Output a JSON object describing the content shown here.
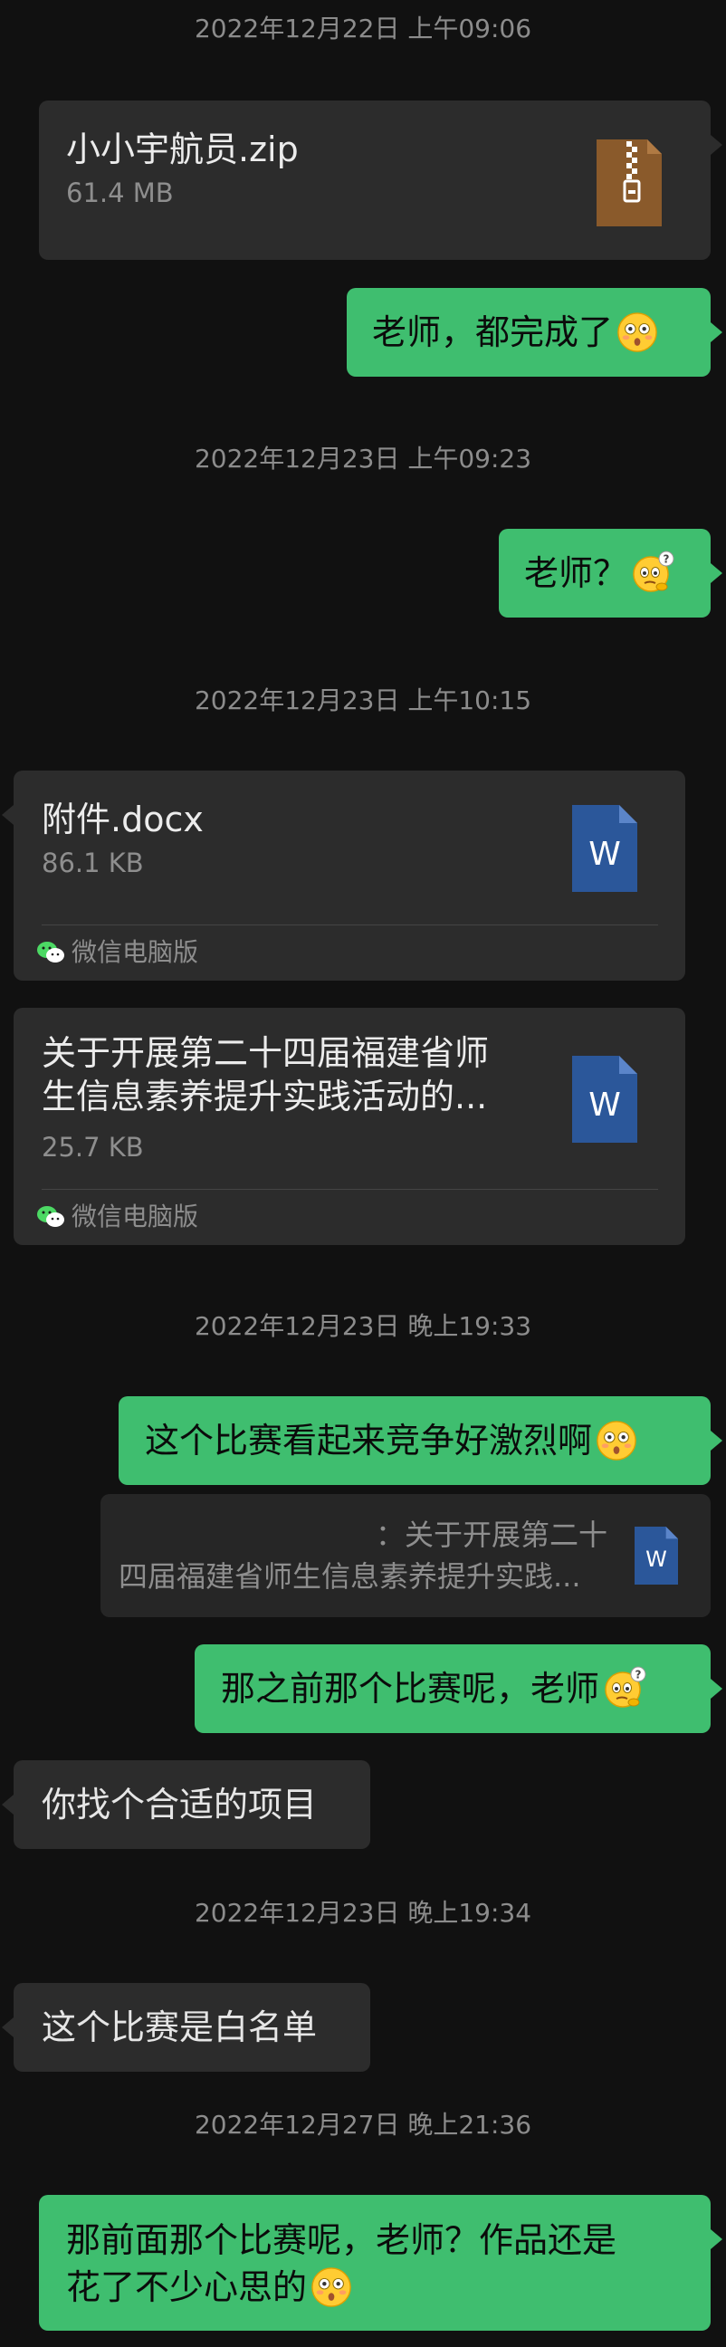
{
  "messages": {
    "ts1": "2022年12月22日 上午09:06",
    "zip_name": "小小宇航员.zip",
    "zip_size": "61.4 MB",
    "msg1": "老师，都完成了",
    "ts2": "2022年12月23日 上午09:23",
    "msg2": "老师？",
    "ts3": "2022年12月23日 上午10:15",
    "doc1_name": "附件.docx",
    "doc1_size": "86.1 KB",
    "doc1_source": "微信电脑版",
    "doc2_name_line1": "关于开展第二十四届福建省师",
    "doc2_name_line2": "生信息素养提升实践活动的...",
    "doc2_size": "25.7 KB",
    "doc2_source": "微信电脑版",
    "ts4": "2022年12月23日 晚上19:33",
    "msg3": "这个比赛看起来竞争好激烈啊",
    "quote_line1": "：关于开展第二十",
    "quote_line2": "四届福建省师生信息素养提升实践...",
    "msg4": "那之前那个比赛呢，老师",
    "msg5": "你找个合适的项目",
    "ts5": "2022年12月23日 晚上19:34",
    "msg6": "这个比赛是白名单",
    "ts6": "2022年12月27日 晚上21:36",
    "msg7_line1": "那前面那个比赛呢，老师？作品还是",
    "msg7_line2": "花了不少心思的"
  },
  "icons": {
    "zip": "zip-file-icon",
    "word": "word-doc-icon",
    "wechat": "wechat-logo-icon",
    "emoji_flushed": "flushed-face-emoji",
    "emoji_thinking": "thinking-face-emoji"
  },
  "colors": {
    "background": "#111111",
    "sent_bubble": "#3fbe6f",
    "received_bubble": "#2c2c2c",
    "word_blue": "#2b579a",
    "zip_brown": "#8a5a2b"
  }
}
